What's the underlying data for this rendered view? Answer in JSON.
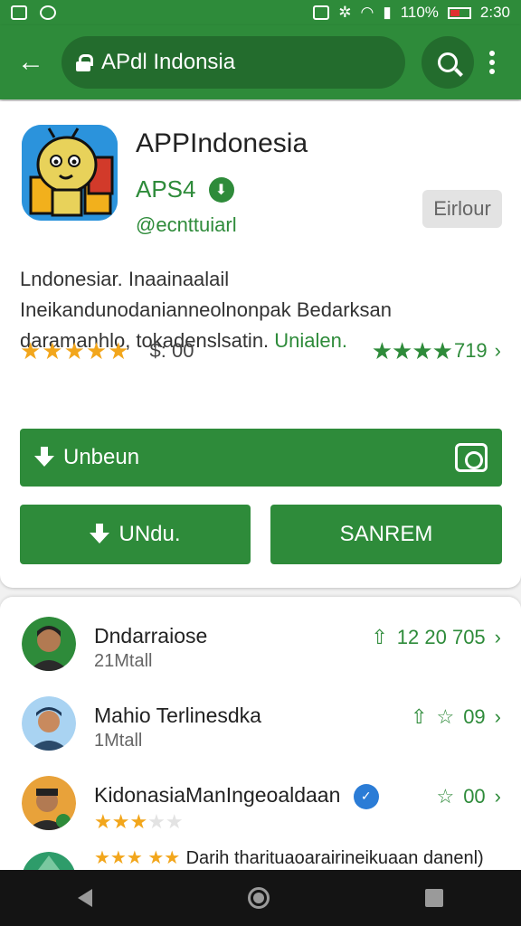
{
  "status_bar": {
    "battery_percent": "110%",
    "time": "2:30"
  },
  "toolbar": {
    "url_text": "APdl Indonsia"
  },
  "app": {
    "title": "APPIndonesia",
    "version": "APS4",
    "developer": "@ecnttuiarl",
    "enroll_label": "Eirlour",
    "description": "Lndonesiar. Inaainaalail Ineikandunodanianneolnonpak Bedarksan daramanhlo, tokadenslsatin.",
    "description_link": "Unialen.",
    "rating_price": "$: 00",
    "green_rating_count": "719"
  },
  "buttons": {
    "main_label": "Unbeun",
    "left_label": "UNdu.",
    "right_label": "SANREM"
  },
  "reviews": [
    {
      "name": "Dndarraiose",
      "sub": "21Mtall",
      "right_text": "12 20 705"
    },
    {
      "name": "Mahio Terlinesdka",
      "sub": "1Mtall",
      "right_text": "09"
    },
    {
      "name": "KidonasiaManIngeoaldaan",
      "sub": "",
      "right_text": "00"
    },
    {
      "name": "Darih tharituaoarairineikuaan danenl)",
      "sub": "",
      "right_text": ""
    }
  ],
  "colors": {
    "brand_green": "#2e8b3a",
    "star_orange": "#f2a61c"
  }
}
